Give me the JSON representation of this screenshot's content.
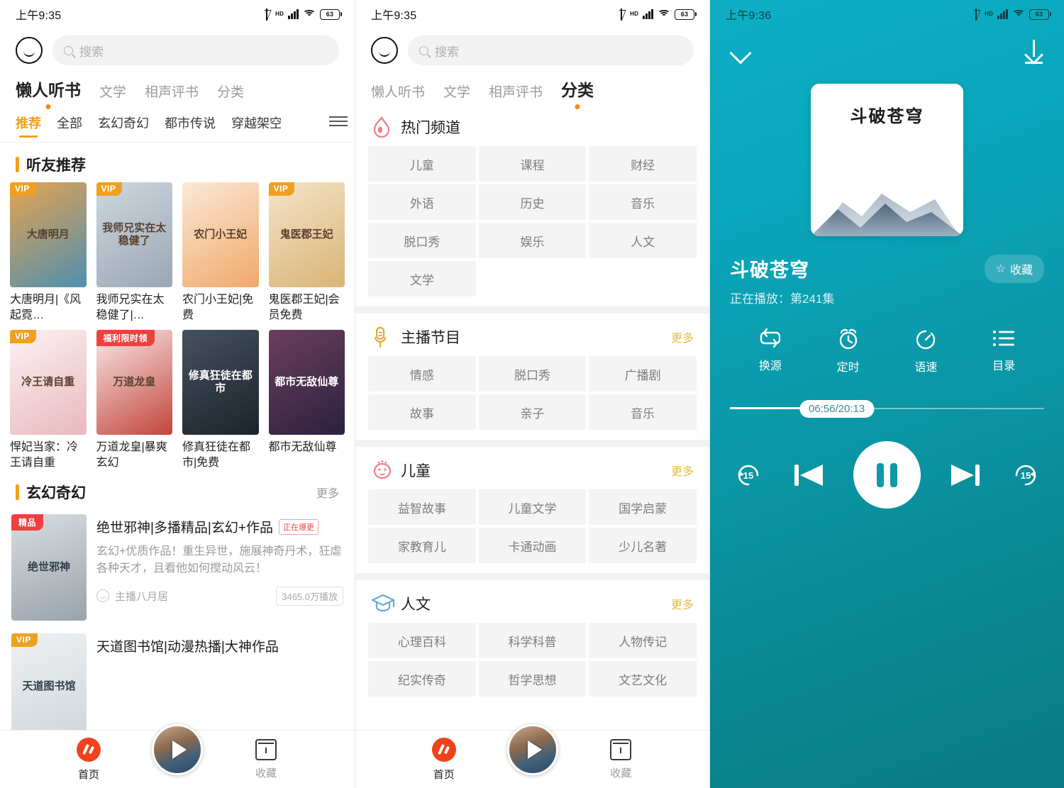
{
  "status_bar": {
    "time_left": "上午9:35",
    "time_right": "上午9:36",
    "battery": "63",
    "hd_label": "HD"
  },
  "search": {
    "placeholder": "搜索"
  },
  "top_tabs": [
    {
      "label": "懒人听书",
      "active": true,
      "dot": true
    },
    {
      "label": "文学",
      "active": false,
      "dot": false
    },
    {
      "label": "相声评书",
      "active": false,
      "dot": false
    },
    {
      "label": "分类",
      "active": false,
      "dot": false
    }
  ],
  "top_tabs_panel2": [
    {
      "label": "懒人听书",
      "active": false,
      "dot": false
    },
    {
      "label": "文学",
      "active": false,
      "dot": false
    },
    {
      "label": "相声评书",
      "active": false,
      "dot": false
    },
    {
      "label": "分类",
      "active": true,
      "dot": true
    }
  ],
  "sub_tabs": [
    {
      "label": "推荐",
      "active": true
    },
    {
      "label": "全部",
      "active": false
    },
    {
      "label": "玄幻奇幻",
      "active": false
    },
    {
      "label": "都市传说",
      "active": false
    },
    {
      "label": "穿越架空",
      "active": false
    }
  ],
  "home": {
    "section1_title": "听友推荐",
    "section2_title": "玄幻奇幻",
    "more_label": "更多",
    "books": [
      {
        "title": "大唐明月|《风起霓…",
        "tag": "VIP",
        "tag_type": "vip",
        "cover_text": "大唐明月",
        "c1": "#e6a34f",
        "c2": "#4e8fb0"
      },
      {
        "title": "我师兄实在太稳健了|…",
        "tag": "VIP",
        "tag_type": "vip",
        "cover_text": "我师兄实在太稳健了",
        "c1": "#cfd7de",
        "c2": "#9aa7b4"
      },
      {
        "title": "农门小王妃|免费",
        "tag": "",
        "tag_type": "none",
        "cover_text": "农门小王妃",
        "c1": "#fbe9d8",
        "c2": "#f0a868"
      },
      {
        "title": "鬼医郡王妃|会员免费",
        "tag": "VIP",
        "tag_type": "vip",
        "cover_text": "鬼医郡王妃",
        "c1": "#f4e4c9",
        "c2": "#d9b475"
      },
      {
        "title": "悍妃当家：冷王请自重",
        "tag": "VIP",
        "tag_type": "vip",
        "cover_text": "冷王请自重",
        "c1": "#fdf1f3",
        "c2": "#e7b9bd"
      },
      {
        "title": "万道龙皇|暴爽玄幻",
        "tag": "福利限时领",
        "tag_type": "red",
        "cover_text": "万道龙皇",
        "c1": "#fbeaea",
        "c2": "#c1453b"
      },
      {
        "title": "修真狂徒在都市|免费",
        "tag": "",
        "tag_type": "none",
        "cover_text": "修真狂徒在都市",
        "c1": "#46525e",
        "c2": "#1c232b"
      },
      {
        "title": "都市无敌仙尊",
        "tag": "",
        "tag_type": "none",
        "cover_text": "都市无敌仙尊",
        "c1": "#6b3f5c",
        "c2": "#2b2140"
      }
    ],
    "list_items": [
      {
        "tag": "精品",
        "title": "绝世邪神|多播精品|玄幻+作品",
        "badge": "正在爆更",
        "desc": "玄幻+优质作品！重生异世，施展神奇丹术，狂虐各种天才，且看他如何搅动风云！",
        "anchor": "主播八月居",
        "plays": "3465.0万播放",
        "cover_text": "绝世邪神",
        "c1": "#d9dde0",
        "c2": "#9aa3ab"
      },
      {
        "tag": "VIP",
        "title": "天道图书馆|动漫热播|大神作品",
        "badge": "",
        "desc": "",
        "anchor": "",
        "plays": "",
        "cover_text": "天道图书馆",
        "c1": "#eef1f3",
        "c2": "#cfd6db"
      }
    ]
  },
  "categories": {
    "more_label": "更多",
    "sections": [
      {
        "title": "热门频道",
        "icon": "flame-icon",
        "show_more": false,
        "chips": [
          "儿童",
          "课程",
          "财经",
          "外语",
          "历史",
          "音乐",
          "脱口秀",
          "娱乐",
          "人文",
          "文学"
        ]
      },
      {
        "title": "主播节目",
        "icon": "microphone-icon",
        "show_more": true,
        "chips": [
          "情感",
          "脱口秀",
          "广播剧",
          "故事",
          "亲子",
          "音乐"
        ]
      },
      {
        "title": "儿童",
        "icon": "baby-face-icon",
        "show_more": true,
        "chips": [
          "益智故事",
          "儿童文学",
          "国学启蒙",
          "家教育儿",
          "卡通动画",
          "少儿名著"
        ]
      },
      {
        "title": "人文",
        "icon": "graduation-cap-icon",
        "show_more": true,
        "chips": [
          "心理百科",
          "科学科普",
          "人物传记",
          "纪实传奇",
          "哲学思想",
          "文艺文化"
        ]
      }
    ]
  },
  "bottom_nav": [
    {
      "label": "首页",
      "icon": "home-icon",
      "active": true
    },
    {
      "label": "收藏",
      "icon": "favorites-icon",
      "active": false
    }
  ],
  "player": {
    "cover_title": "斗破苍穹",
    "title": "斗破苍穹",
    "subtitle": "正在播放：第241集",
    "fav_label": "收藏",
    "fav_icon": "star-outline-icon",
    "collapse_icon": "chevron-down-icon",
    "download_icon": "download-icon",
    "actions": [
      {
        "label": "换源",
        "icon": "repeat-icon"
      },
      {
        "label": "定时",
        "icon": "alarm-clock-icon"
      },
      {
        "label": "语速",
        "icon": "speed-icon"
      },
      {
        "label": "目录",
        "icon": "list-icon"
      }
    ],
    "progress": {
      "current": "06:56",
      "total": "20:13",
      "display": "06:56/20:13",
      "percent": 34
    },
    "controls": [
      {
        "icon": "rewind-15-icon",
        "label": "15"
      },
      {
        "icon": "previous-track-icon",
        "label": ""
      },
      {
        "icon": "pause-icon",
        "label": ""
      },
      {
        "icon": "next-track-icon",
        "label": ""
      },
      {
        "icon": "forward-15-icon",
        "label": "15"
      }
    ],
    "accent_color": "#0b9fae"
  }
}
